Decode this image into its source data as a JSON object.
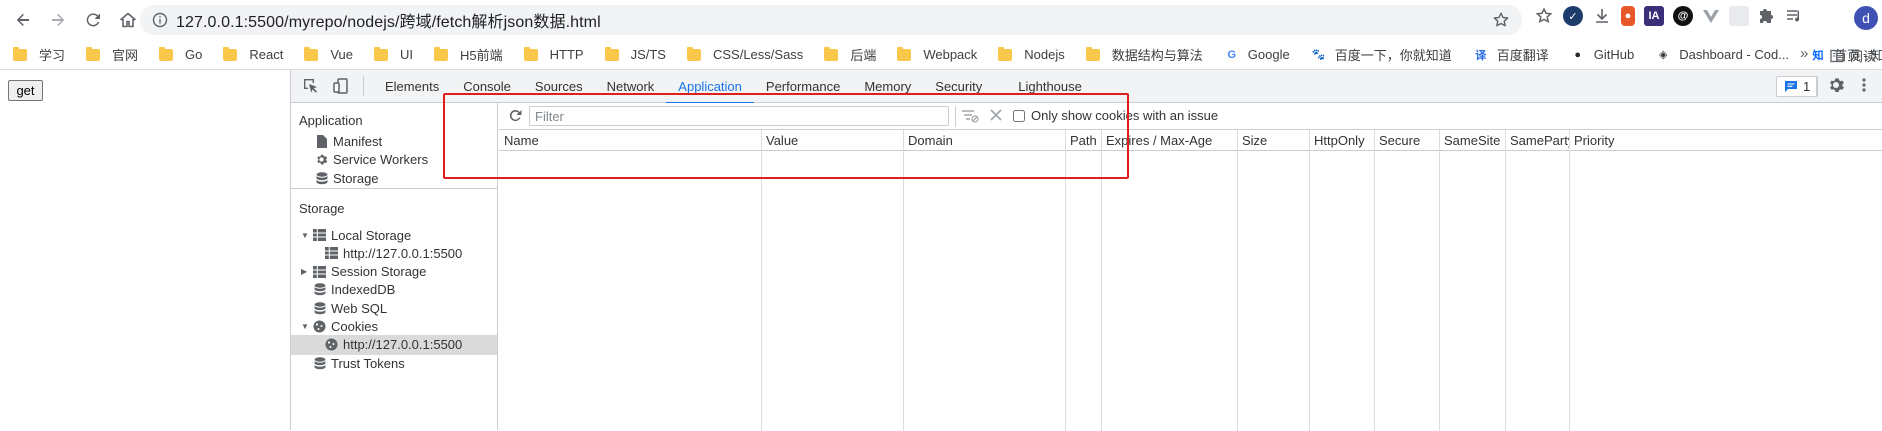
{
  "browser": {
    "url": "127.0.0.1:5500/myrepo/nodejs/跨域/fetch解析json数据.html",
    "profile_initial": "d",
    "extensions": [
      "IA"
    ]
  },
  "bookmarks": [
    {
      "label": "学习",
      "type": "folder"
    },
    {
      "label": "官网",
      "type": "folder"
    },
    {
      "label": "Go",
      "type": "folder"
    },
    {
      "label": "React",
      "type": "folder"
    },
    {
      "label": "Vue",
      "type": "folder"
    },
    {
      "label": "UI",
      "type": "folder"
    },
    {
      "label": "H5前端",
      "type": "folder"
    },
    {
      "label": "HTTP",
      "type": "folder"
    },
    {
      "label": "JS/TS",
      "type": "folder"
    },
    {
      "label": "CSS/Less/Sass",
      "type": "folder"
    },
    {
      "label": "后端",
      "type": "folder"
    },
    {
      "label": "Webpack",
      "type": "folder"
    },
    {
      "label": "Nodejs",
      "type": "folder"
    },
    {
      "label": "数据结构与算法",
      "type": "folder"
    },
    {
      "label": "Google",
      "type": "site",
      "icon": "google-icon",
      "glyph": "G",
      "color": "#4285f4"
    },
    {
      "label": "百度一下，你就知道",
      "type": "site",
      "icon": "baidu-icon",
      "glyph": "🐾",
      "color": "#2932e1"
    },
    {
      "label": "百度翻译",
      "type": "site",
      "icon": "baidu-translate-icon",
      "glyph": "译",
      "color": "#2b6de5"
    },
    {
      "label": "GitHub",
      "type": "site",
      "icon": "github-icon",
      "glyph": "●",
      "color": "#24292e"
    },
    {
      "label": "Dashboard - Cod...",
      "type": "site",
      "icon": "codepen-icon",
      "glyph": "◈",
      "color": "#333333"
    },
    {
      "label": "首页 - 知乎",
      "type": "site",
      "icon": "zhihu-icon",
      "glyph": "知",
      "color": "#0066ff"
    }
  ],
  "bookmarks_overflow": "»",
  "reading_list": "阅读",
  "page": {
    "button_label": "get"
  },
  "devtools": {
    "tabs": [
      "Elements",
      "Console",
      "Sources",
      "Network",
      "Application",
      "Performance",
      "Memory",
      "Security",
      "Lighthouse"
    ],
    "active_tab": "Application",
    "issues_count": "1",
    "sidebar": {
      "application_title": "Application",
      "application_items": [
        {
          "label": "Manifest",
          "icon": "file-icon"
        },
        {
          "label": "Service Workers",
          "icon": "gear-icon"
        },
        {
          "label": "Storage",
          "icon": "database-icon"
        }
      ],
      "storage_title": "Storage",
      "storage_items": [
        {
          "label": "Local Storage",
          "icon": "grid-icon",
          "expanded": true,
          "level": 0
        },
        {
          "label": "http://127.0.0.1:5500",
          "icon": "grid-icon",
          "level": 1
        },
        {
          "label": "Session Storage",
          "icon": "grid-icon",
          "expanded": false,
          "level": 0
        },
        {
          "label": "IndexedDB",
          "icon": "database-icon",
          "level": 0
        },
        {
          "label": "Web SQL",
          "icon": "database-icon",
          "level": 0
        },
        {
          "label": "Cookies",
          "icon": "cookie-icon",
          "expanded": true,
          "level": 0
        },
        {
          "label": "http://127.0.0.1:5500",
          "icon": "cookie-icon",
          "level": 1,
          "selected": true
        },
        {
          "label": "Trust Tokens",
          "icon": "database-icon",
          "level": 0
        }
      ]
    },
    "cookies": {
      "filter_placeholder": "Filter",
      "filter_value": "",
      "only_issues_label": "Only show cookies with an issue",
      "only_issues_checked": false,
      "columns": [
        "Name",
        "Value",
        "Domain",
        "Path",
        "Expires / Max-Age",
        "Size",
        "HttpOnly",
        "Secure",
        "SameSite",
        "SameParty",
        "Priority"
      ],
      "rows": []
    }
  },
  "colors": {
    "accent": "#1a73e8",
    "highlight": "#e01e1e",
    "folder": "#f9c84b"
  }
}
